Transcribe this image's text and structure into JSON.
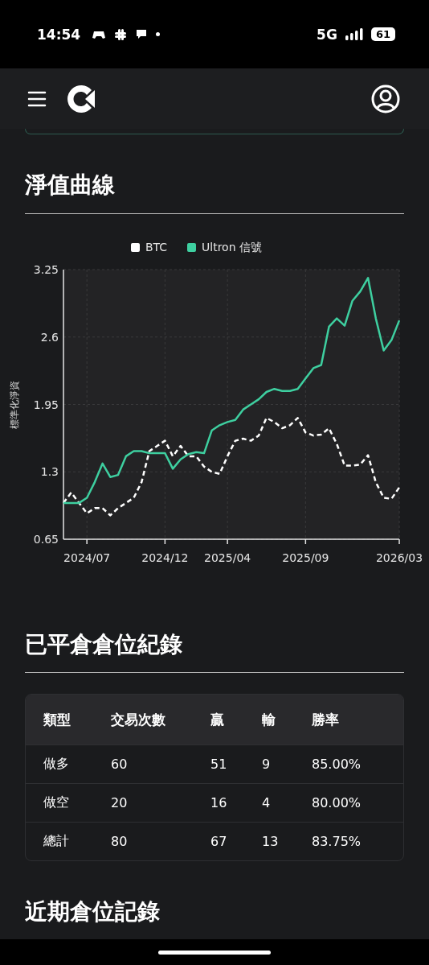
{
  "status_bar": {
    "time": "14:54",
    "network": "5G",
    "battery": "61"
  },
  "sections": [
    {
      "title": "淨值曲線",
      "chart_data": {
        "type": "line",
        "ylabel": "標準化淨資",
        "categories": [
          null,
          null,
          null,
          "2024/07",
          null,
          null,
          null,
          null,
          null,
          null,
          null,
          null,
          null,
          "2024/12",
          null,
          null,
          null,
          null,
          null,
          null,
          null,
          "2025/04",
          null,
          null,
          null,
          null,
          null,
          null,
          null,
          null,
          null,
          "2025/09",
          null,
          null,
          null,
          null,
          null,
          null,
          null,
          null,
          null,
          null,
          null,
          "2026/03"
        ],
        "series": [
          {
            "name": "BTC",
            "color": "#ffffff",
            "line_style": "dashed",
            "values": [
              1.0,
              1.1,
              1.0,
              0.9,
              0.95,
              0.95,
              0.88,
              0.95,
              1.0,
              1.05,
              1.2,
              1.5,
              1.55,
              1.6,
              1.45,
              1.55,
              1.45,
              1.45,
              1.35,
              1.3,
              1.28,
              1.45,
              1.6,
              1.62,
              1.6,
              1.65,
              1.82,
              1.78,
              1.72,
              1.75,
              1.82,
              1.68,
              1.65,
              1.66,
              1.72,
              1.57,
              1.36,
              1.36,
              1.37,
              1.46,
              1.2,
              1.05,
              1.04,
              1.15
            ]
          },
          {
            "name": "Ultron 信號",
            "color": "#3ecfa0",
            "line_style": "solid",
            "values": [
              1.0,
              1.0,
              1.0,
              1.05,
              1.2,
              1.38,
              1.25,
              1.27,
              1.45,
              1.5,
              1.5,
              1.48,
              1.48,
              1.48,
              1.33,
              1.42,
              1.47,
              1.49,
              1.48,
              1.7,
              1.75,
              1.78,
              1.8,
              1.9,
              1.95,
              2.0,
              2.07,
              2.1,
              2.08,
              2.08,
              2.1,
              2.2,
              2.3,
              2.33,
              2.7,
              2.78,
              2.71,
              2.95,
              3.04,
              3.17,
              2.78,
              2.47,
              2.57,
              2.76
            ]
          }
        ],
        "grid": true,
        "legend": true,
        "ylim": [
          0.65,
          3.25
        ],
        "yticks": [
          0.65,
          1.3,
          1.95,
          2.6,
          3.25
        ]
      }
    },
    {
      "title": "已平倉倉位紀錄",
      "table": {
        "columns": [
          "類型",
          "交易次數",
          "贏",
          "輸",
          "勝率"
        ],
        "rows": [
          [
            "做多",
            "60",
            "51",
            "9",
            "85.00%"
          ],
          [
            "做空",
            "20",
            "16",
            "4",
            "80.00%"
          ],
          [
            "總計",
            "80",
            "67",
            "13",
            "83.75%"
          ]
        ]
      }
    },
    {
      "title": "近期倉位記錄"
    }
  ]
}
